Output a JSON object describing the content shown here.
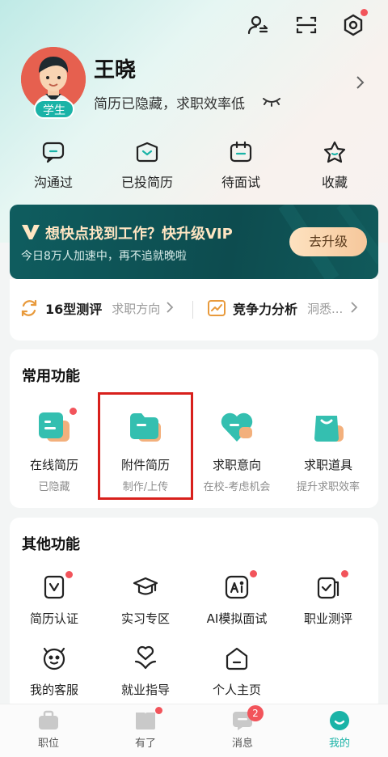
{
  "header": {
    "icons": [
      "contacts-swap-icon",
      "scan-icon",
      "settings-icon"
    ]
  },
  "profile": {
    "name": "王晓",
    "badge": "学生",
    "status": "简历已隐藏，求职效率低"
  },
  "quick_stats": [
    {
      "label": "沟通过",
      "icon": "chat-icon"
    },
    {
      "label": "已投简历",
      "icon": "sent-resume-icon"
    },
    {
      "label": "待面试",
      "icon": "calendar-icon"
    },
    {
      "label": "收藏",
      "icon": "star-icon"
    }
  ],
  "vip": {
    "title": "想快点找到工作？快升级VIP",
    "subtitle": "今日8万人加速中，再不追就晚啦",
    "button": "去升级",
    "accent": "#0f5d5f"
  },
  "assessments": [
    {
      "title": "16型测评",
      "subtitle": "求职方向"
    },
    {
      "title": "竞争力分析",
      "subtitle": "洞悉..."
    }
  ],
  "common_functions": {
    "title": "常用功能",
    "items": [
      {
        "label": "在线简历",
        "sub": "已隐藏"
      },
      {
        "label": "附件简历",
        "sub": "制作/上传"
      },
      {
        "label": "求职意向",
        "sub": "在校-考虑机会"
      },
      {
        "label": "求职道具",
        "sub": "提升求职效率"
      }
    ]
  },
  "other_functions": {
    "title": "其他功能",
    "items": [
      {
        "label": "简历认证"
      },
      {
        "label": "实习专区"
      },
      {
        "label": "AI模拟面试"
      },
      {
        "label": "职业测评"
      },
      {
        "label": "我的客服"
      },
      {
        "label": "就业指导"
      },
      {
        "label": "个人主页"
      }
    ]
  },
  "bottom_nav": [
    {
      "label": "职位"
    },
    {
      "label": "有了"
    },
    {
      "label": "消息",
      "badge": "2"
    },
    {
      "label": "我的"
    }
  ],
  "colors": {
    "brand": "#1ab3a7",
    "alert": "#f2545b",
    "highlight_box": "#d8201c"
  }
}
